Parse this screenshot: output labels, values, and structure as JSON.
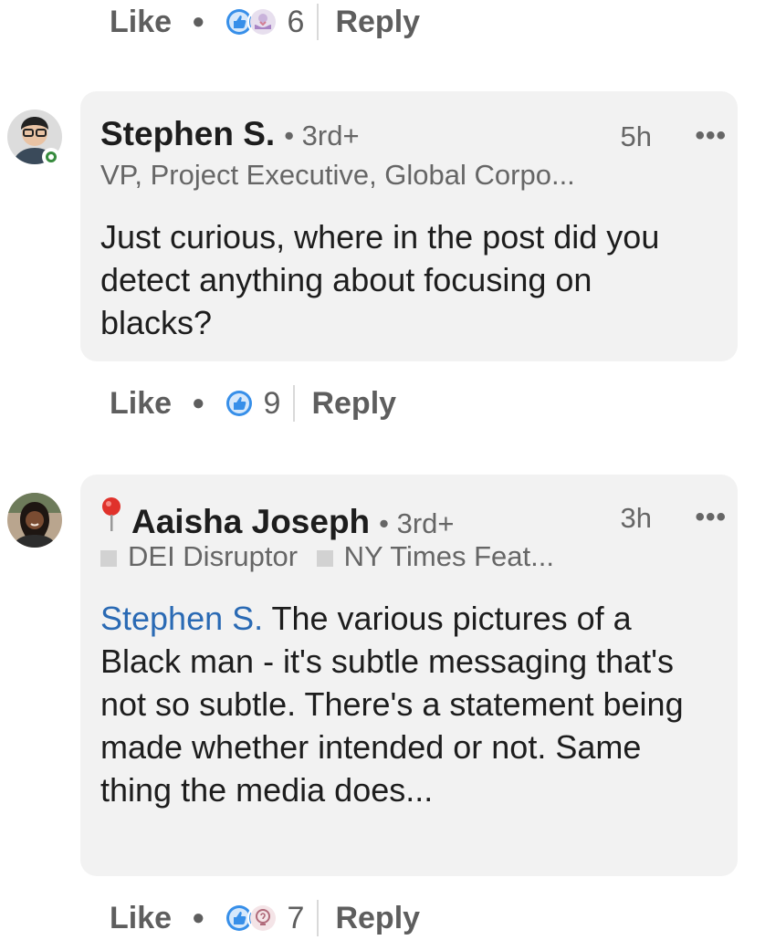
{
  "top_actions": {
    "like_label": "Like",
    "reaction_count": "6",
    "reply_label": "Reply",
    "reaction_icons": [
      "like-reaction-icon",
      "support-reaction-icon"
    ]
  },
  "comments": [
    {
      "name": "Stephen S.",
      "degree": "• 3rd+",
      "time": "5h",
      "more": "•••",
      "headline": "VP, Project Executive, Global Corpo...",
      "body": "Just curious, where in the post did you detect anything about focusing on blacks?",
      "like_label": "Like",
      "reaction_count": "9",
      "reply_label": "Reply",
      "reaction_icons": [
        "like-reaction-icon"
      ]
    },
    {
      "name": "Aaisha Joseph",
      "degree": "• 3rd+",
      "time": "3h",
      "more": "•••",
      "headline_part1": "DEI Disruptor",
      "headline_part2": "NY Times Feat...",
      "mention": "Stephen S.",
      "body": " The various pictures of a Black man - it's subtle messaging that's not so subtle. There's a statement being made whether intended or not. Same thing the media does...",
      "like_label": "Like",
      "reaction_count": "7",
      "reply_label": "Reply",
      "reaction_icons": [
        "like-reaction-icon",
        "insightful-reaction-icon"
      ]
    }
  ],
  "colors": {
    "bubble_bg": "#f2f2f2",
    "mention": "#2a6ab4",
    "like_reaction": "#378fe9",
    "online": "#378b3e"
  }
}
